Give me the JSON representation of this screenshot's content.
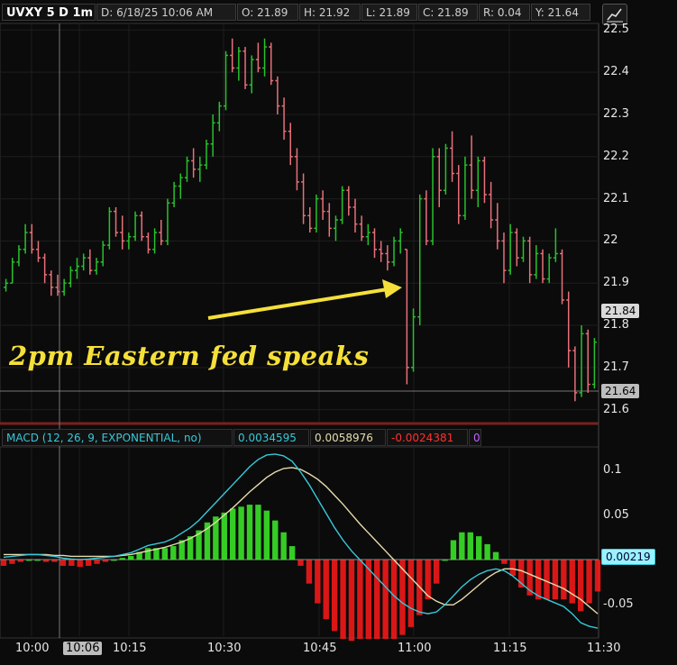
{
  "header": {
    "symbol": "UVXY 5 D 1m",
    "date": "D: 6/18/25 10:06 AM",
    "open": "O: 21.89",
    "high": "H: 21.92",
    "low": "L: 21.89",
    "close": "C: 21.89",
    "range": "R: 0.04",
    "y": "Y: 21.64"
  },
  "annotation": "2pm Eastern fed speaks",
  "macd_header": {
    "study": "MACD (12, 26, 9, EXPONENTIAL, no)",
    "value": "0.0034595",
    "avg": "0.0058976",
    "diff": "-0.0024381",
    "extra": "0"
  },
  "price_axis": [
    "22.5",
    "22.4",
    "22.3",
    "22.2",
    "22.1",
    "22",
    "21.9",
    "21.8",
    "21.7",
    "21.6"
  ],
  "price_boxes": {
    "last": "21.84",
    "cursor": "21.64"
  },
  "macd_axis": [
    "0.1",
    "0.05",
    "-0.05"
  ],
  "macd_box": "0.00219",
  "time_axis": [
    "10:00",
    "10:06",
    "10:15",
    "10:30",
    "10:45",
    "11:00",
    "11:15",
    "11:30"
  ],
  "colors": {
    "up": "#27c22b",
    "down": "#e8707a",
    "macd": "#38c8d8",
    "avg": "#e7dcae",
    "hist_up": "#3dee2a",
    "hist_down": "#ff1a1a",
    "arrow": "#f5e03a"
  },
  "chart_data": {
    "type": "candlestick",
    "interval": "1m",
    "ylim": [
      21.58,
      22.52
    ],
    "candles": [
      [
        21.89,
        21.91,
        21.88,
        21.9
      ],
      [
        21.9,
        21.96,
        21.9,
        21.95
      ],
      [
        21.95,
        21.99,
        21.94,
        21.98
      ],
      [
        21.98,
        22.04,
        21.97,
        22.02
      ],
      [
        22.02,
        22.04,
        21.97,
        21.98
      ],
      [
        21.98,
        22.0,
        21.95,
        21.96
      ],
      [
        21.96,
        21.97,
        21.9,
        21.92
      ],
      [
        21.92,
        21.93,
        21.87,
        21.89
      ],
      [
        21.89,
        21.92,
        21.87,
        21.88
      ],
      [
        21.88,
        21.91,
        21.87,
        21.9
      ],
      [
        21.9,
        21.94,
        21.89,
        21.93
      ],
      [
        21.93,
        21.96,
        21.91,
        21.94
      ],
      [
        21.94,
        21.97,
        21.93,
        21.96
      ],
      [
        21.96,
        21.98,
        21.92,
        21.93
      ],
      [
        21.93,
        21.96,
        21.92,
        21.95
      ],
      [
        21.95,
        22.0,
        21.94,
        21.99
      ],
      [
        21.99,
        22.08,
        21.98,
        22.07
      ],
      [
        22.07,
        22.08,
        22.01,
        22.02
      ],
      [
        22.02,
        22.06,
        21.98,
        22.0
      ],
      [
        22.0,
        22.02,
        21.98,
        22.01
      ],
      [
        22.01,
        22.07,
        22.0,
        22.06
      ],
      [
        22.06,
        22.07,
        22.0,
        22.01
      ],
      [
        22.01,
        22.02,
        21.97,
        21.98
      ],
      [
        21.98,
        22.03,
        21.97,
        22.02
      ],
      [
        22.02,
        22.05,
        21.99,
        22.0
      ],
      [
        22.0,
        22.1,
        21.99,
        22.09
      ],
      [
        22.09,
        22.14,
        22.08,
        22.13
      ],
      [
        22.13,
        22.16,
        22.1,
        22.15
      ],
      [
        22.15,
        22.2,
        22.14,
        22.19
      ],
      [
        22.19,
        22.22,
        22.15,
        22.17
      ],
      [
        22.17,
        22.2,
        22.14,
        22.18
      ],
      [
        22.18,
        22.24,
        22.17,
        22.23
      ],
      [
        22.23,
        22.3,
        22.2,
        22.28
      ],
      [
        22.28,
        22.33,
        22.26,
        22.32
      ],
      [
        22.32,
        22.45,
        22.31,
        22.44
      ],
      [
        22.44,
        22.48,
        22.4,
        22.41
      ],
      [
        22.41,
        22.46,
        22.38,
        22.45
      ],
      [
        22.45,
        22.46,
        22.36,
        22.37
      ],
      [
        22.37,
        22.44,
        22.35,
        22.43
      ],
      [
        22.43,
        22.47,
        22.4,
        22.41
      ],
      [
        22.41,
        22.48,
        22.39,
        22.46
      ],
      [
        22.46,
        22.47,
        22.37,
        22.38
      ],
      [
        22.38,
        22.39,
        22.3,
        22.32
      ],
      [
        22.32,
        22.34,
        22.24,
        22.26
      ],
      [
        22.26,
        22.28,
        22.18,
        22.2
      ],
      [
        22.2,
        22.22,
        22.12,
        22.14
      ],
      [
        22.14,
        22.16,
        22.04,
        22.06
      ],
      [
        22.06,
        22.08,
        22.02,
        22.03
      ],
      [
        22.03,
        22.11,
        22.02,
        22.1
      ],
      [
        22.1,
        22.12,
        22.05,
        22.07
      ],
      [
        22.07,
        22.09,
        22.01,
        22.03
      ],
      [
        22.03,
        22.06,
        22.0,
        22.05
      ],
      [
        22.05,
        22.13,
        22.04,
        22.12
      ],
      [
        22.12,
        22.13,
        22.06,
        22.08
      ],
      [
        22.08,
        22.1,
        22.02,
        22.04
      ],
      [
        22.04,
        22.06,
        22.0,
        22.01
      ],
      [
        22.01,
        22.04,
        21.99,
        22.02
      ],
      [
        22.02,
        22.03,
        21.96,
        21.98
      ],
      [
        21.98,
        22.0,
        21.95,
        21.97
      ],
      [
        21.97,
        21.99,
        21.93,
        21.95
      ],
      [
        21.95,
        22.01,
        21.94,
        22.0
      ],
      [
        22.0,
        22.03,
        21.97,
        22.02
      ],
      [
        21.98,
        21.98,
        21.66,
        21.7
      ],
      [
        21.7,
        21.84,
        21.69,
        21.82
      ],
      [
        21.82,
        22.11,
        21.8,
        22.1
      ],
      [
        22.1,
        22.12,
        21.99,
        22.0
      ],
      [
        22.0,
        22.22,
        21.99,
        22.2
      ],
      [
        22.2,
        22.22,
        22.08,
        22.12
      ],
      [
        22.12,
        22.23,
        22.11,
        22.22
      ],
      [
        22.22,
        22.26,
        22.14,
        22.16
      ],
      [
        22.16,
        22.18,
        22.04,
        22.06
      ],
      [
        22.06,
        22.2,
        22.05,
        22.18
      ],
      [
        22.18,
        22.25,
        22.1,
        22.12
      ],
      [
        22.12,
        22.2,
        22.08,
        22.19
      ],
      [
        22.19,
        22.2,
        22.09,
        22.11
      ],
      [
        22.11,
        22.14,
        22.03,
        22.05
      ],
      [
        22.05,
        22.09,
        21.98,
        22.0
      ],
      [
        22.0,
        22.02,
        21.9,
        21.93
      ],
      [
        21.93,
        22.04,
        21.92,
        22.02
      ],
      [
        22.02,
        22.03,
        21.94,
        21.96
      ],
      [
        21.96,
        22.01,
        21.95,
        22.0
      ],
      [
        22.0,
        22.01,
        21.9,
        21.92
      ],
      [
        21.92,
        21.99,
        21.91,
        21.97
      ],
      [
        21.97,
        21.98,
        21.9,
        21.91
      ],
      [
        21.91,
        21.97,
        21.9,
        21.96
      ],
      [
        21.96,
        22.03,
        21.95,
        21.97
      ],
      [
        21.97,
        21.98,
        21.85,
        21.86
      ],
      [
        21.86,
        21.88,
        21.7,
        21.74
      ],
      [
        21.74,
        21.75,
        21.62,
        21.64
      ],
      [
        21.64,
        21.8,
        21.63,
        21.78
      ],
      [
        21.78,
        21.79,
        21.64,
        21.66
      ],
      [
        21.66,
        21.77,
        21.65,
        21.76
      ]
    ],
    "macd_line": [
      0.003,
      0.004,
      0.005,
      0.006,
      0.006,
      0.005,
      0.004,
      0.002,
      0.001,
      0.0005,
      0.001,
      0.002,
      0.003,
      0.004,
      0.006,
      0.008,
      0.012,
      0.016,
      0.018,
      0.02,
      0.024,
      0.03,
      0.036,
      0.044,
      0.054,
      0.064,
      0.074,
      0.084,
      0.094,
      0.104,
      0.112,
      0.117,
      0.118,
      0.116,
      0.11,
      0.098,
      0.084,
      0.068,
      0.052,
      0.036,
      0.022,
      0.01,
      0.0,
      -0.01,
      -0.02,
      -0.03,
      -0.04,
      -0.048,
      -0.054,
      -0.058,
      -0.06,
      -0.058,
      -0.05,
      -0.04,
      -0.03,
      -0.022,
      -0.016,
      -0.012,
      -0.01,
      -0.012,
      -0.018,
      -0.026,
      -0.034,
      -0.04,
      -0.044,
      -0.048,
      -0.052,
      -0.06,
      -0.07,
      -0.074,
      -0.076
    ],
    "macd_avg": [
      0.006,
      0.006,
      0.006,
      0.006,
      0.006,
      0.006,
      0.005,
      0.005,
      0.004,
      0.004,
      0.004,
      0.004,
      0.004,
      0.004,
      0.005,
      0.006,
      0.008,
      0.01,
      0.012,
      0.014,
      0.017,
      0.02,
      0.024,
      0.029,
      0.035,
      0.042,
      0.05,
      0.058,
      0.067,
      0.076,
      0.084,
      0.092,
      0.098,
      0.102,
      0.103,
      0.101,
      0.096,
      0.09,
      0.082,
      0.072,
      0.062,
      0.051,
      0.04,
      0.03,
      0.02,
      0.01,
      0.0,
      -0.01,
      -0.02,
      -0.03,
      -0.04,
      -0.046,
      -0.05,
      -0.05,
      -0.044,
      -0.036,
      -0.028,
      -0.02,
      -0.014,
      -0.01,
      -0.01,
      -0.012,
      -0.016,
      -0.02,
      -0.024,
      -0.028,
      -0.032,
      -0.038,
      -0.044,
      -0.052,
      -0.06
    ],
    "macd_ylim": [
      -0.085,
      0.125
    ]
  }
}
